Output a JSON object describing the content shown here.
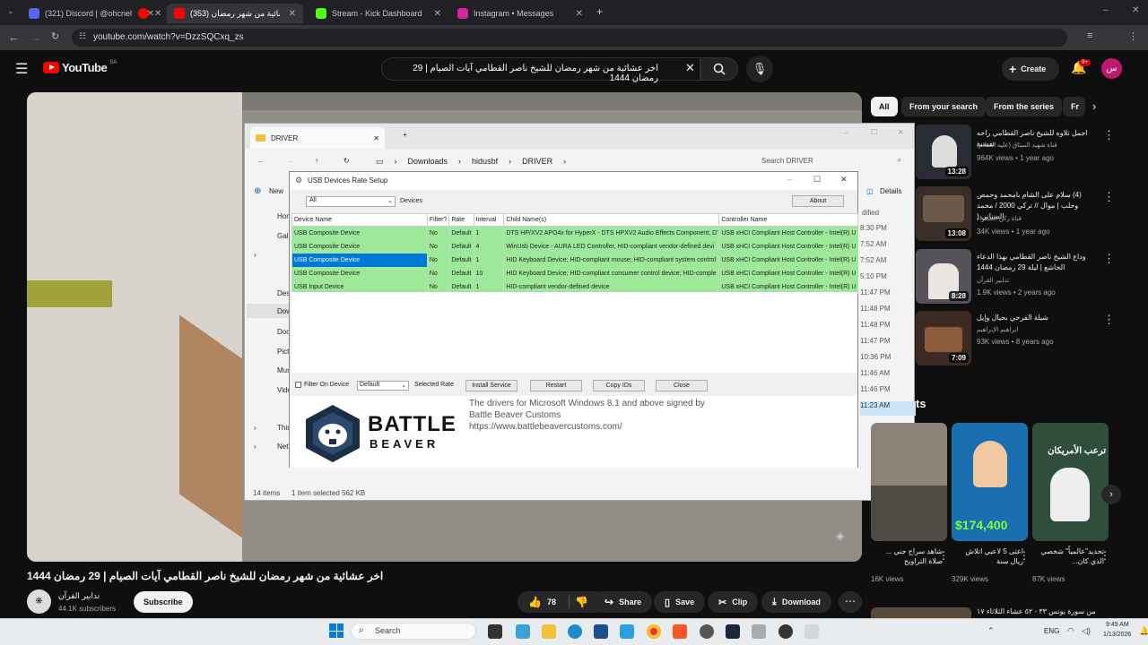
{
  "browser": {
    "tabs": [
      {
        "label": "(321) Discord | @ohcnel",
        "color": "#5865f2"
      },
      {
        "label": "",
        "color": "#ff0000"
      },
      {
        "label": "(353) اخر عشائية من شهر رمضان",
        "color": "#ff0000"
      },
      {
        "label": "Stream - Kick Dashboard",
        "color": "#53fc18"
      },
      {
        "label": "Instagram • Messages",
        "color": "#d6249f"
      }
    ],
    "url": "youtube.com/watch?v=DzzSQCxq_zs"
  },
  "youtube": {
    "logo": "YouTube",
    "region": "SA",
    "search_value": "اخر عشائية من شهر رمضان للشيخ ناصر القطامي آيات الصيام | 29 رمضان 1444",
    "create_label": "Create",
    "notif_count": "9+",
    "avatar_letter": "س"
  },
  "explorer": {
    "tab_title": "DRIVER",
    "breadcrumb": [
      "Downloads",
      "hidusbf",
      "DRIVER"
    ],
    "search_placeholder": "Search DRIVER",
    "new_label": "New",
    "details_label": "Details",
    "modified_header": "dified",
    "side_items": [
      "Hom",
      "Gall",
      "",
      "Des",
      "Dow",
      "Doc",
      "Pict",
      "Mus",
      "Vide",
      "This",
      "Net"
    ],
    "times": [
      "8:30 PM",
      "7:52 AM",
      "7:52 AM",
      "5:10 PM",
      "11:47 PM",
      "11:48 PM",
      "11:48 PM",
      "11:47 PM",
      "10:36 PM",
      "11:46 AM",
      "11:46 PM",
      "11:23 AM"
    ],
    "status_items": "14 items",
    "status_selected": "1 item selected  562 KB"
  },
  "usb_dialog": {
    "title": "USB Devices Rate Setup",
    "filter_combo": "All",
    "devices_label": "Devices",
    "about_button": "About",
    "columns": [
      "Device Name",
      "Filter?",
      "Rate",
      "Interval",
      "Child Name(s)",
      "Controller Name"
    ],
    "rows": [
      [
        "USB Composite Device",
        "No",
        "Default",
        "1",
        "DTS HP/XV2 APO4x for HyperX - DTS HPXV2 Audio Effects Component; DT",
        "USB xHCI Compliant Host Controller - Intel(R) U"
      ],
      [
        "USB Composite Device",
        "No",
        "Default",
        "4",
        "WinUsb Device - AURA LED Controller, HID-compliant vendor-defined devi",
        "USB xHCI Compliant Host Controller - Intel(R) U"
      ],
      [
        "USB Composite Device",
        "No",
        "Default",
        "1",
        "HID Keyboard Device; HID-compliant mouse; HID-compliant system control",
        "USB xHCI Compliant Host Controller - Intel(R) U"
      ],
      [
        "USB Composite Device",
        "No",
        "Default",
        "10",
        "HID Keyboard Device; HID-compliant consumer control device; HID-comple",
        "USB xHCI Compliant Host Controller - Intel(R) U"
      ],
      [
        "USB Input Device",
        "No",
        "Default",
        "1",
        "HID-compliant vendor-defined device",
        "USB xHCI Compliant Host Controller - Intel(R) U"
      ]
    ],
    "filter_on_device": "Filter On Device",
    "rate_combo": "Default",
    "selected_rate": "Selected Rate",
    "install_service": "Install Service",
    "restart": "Restart",
    "copy_ids": "Copy IDs",
    "close": "Close",
    "brand_top": "BATTLE",
    "brand_bottom": "BEAVER",
    "info_line1": "The drivers for Microsoft Windows 8.1 and above signed by",
    "info_line2": "Battle Beaver Customs",
    "info_line3": "https://www.battlebeavercustoms.com/"
  },
  "chips": [
    "All",
    "From your search",
    "From the series",
    "Fr"
  ],
  "recommendations": [
    {
      "title": "اجمل تلاوه للشيخ ناصر القطامي راحه نفسيه",
      "channel": "قناة شهيد الميثاق (عليه السلام)",
      "meta": "964K views • 1 year ago",
      "duration": "13:28"
    },
    {
      "title": "(4) سلام على الشام بامحمد وحمص وحلب | موال // تركي 2000 / محمد السناني (",
      "channel": "قناة ركن الشعراء",
      "meta": "34K views • 1 year ago",
      "duration": "13:08"
    },
    {
      "title": "وداع الشيخ ناصر القطامي بهذا الدعاء الخاشع | ليلة 29 رمضان 1444",
      "channel": "تدابير القرآن",
      "meta": "1.9K views • 2 years ago",
      "duration": "8:28"
    },
    {
      "title": "شيلة الفرحي بحيال وإيل",
      "channel": "ابراهيم الإبراهيم",
      "meta": "93K views • 8 years ago",
      "duration": "7:09"
    }
  ],
  "shorts_heading": "ts",
  "shorts": [
    {
      "title": "شاهد سراج جني ... صلاة التراويح",
      "views": "16K views"
    },
    {
      "title": "اعتى 5 لاعبي اتلاش ريال سنة",
      "views": "329K views"
    },
    {
      "title": "تحديد\"عالمياً\" شخصي الذي كان...",
      "views": "87K views"
    }
  ],
  "short_overlays": {
    "money": "$174,400",
    "banner": "ترعب الأمريكان"
  },
  "video": {
    "title": "اخر عشائية من شهر رمضان للشيخ ناصر القطامي آيات الصيام | 29 رمضان 1444",
    "channel": "تدابير القرآن",
    "subscribers": "44.1K subscribers",
    "subscribe": "Subscribe",
    "likes": "78",
    "share": "Share",
    "save": "Save",
    "clip": "Clip",
    "download": "Download"
  },
  "next_video_title": "من سورة يونس ٣٣ - ٥٢ عشاء الثلاثاء ١٧",
  "taskbar": {
    "search": "Search",
    "lang": "ENG",
    "time": "9:49 AM",
    "date": "1/13/2026"
  }
}
